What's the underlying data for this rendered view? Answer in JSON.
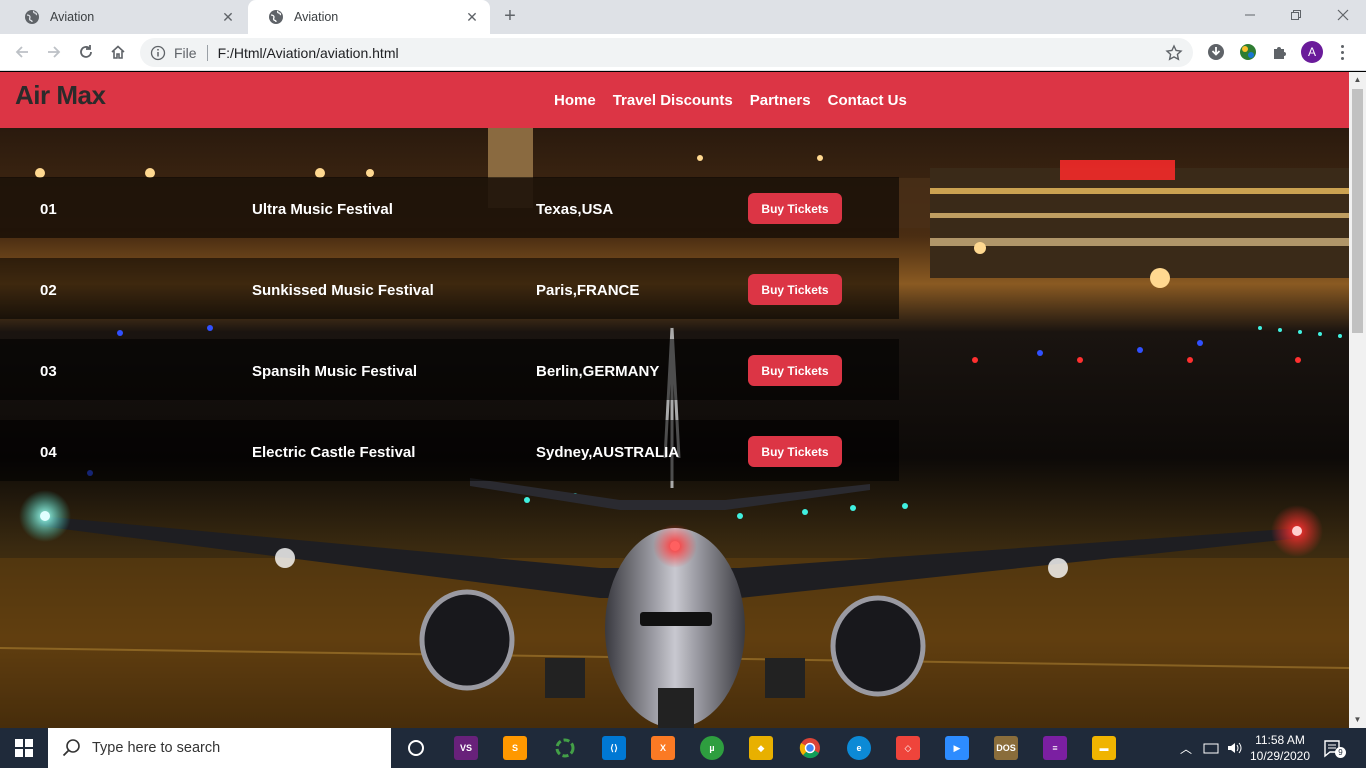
{
  "browser": {
    "tabs": [
      {
        "title": "Aviation",
        "active": false
      },
      {
        "title": "Aviation",
        "active": true
      }
    ],
    "address": {
      "scheme_label": "File",
      "url": "F:/Html/Aviation/aviation.html"
    }
  },
  "site": {
    "brand": "Air Max",
    "nav": [
      "Home",
      "Travel Discounts",
      "Partners",
      "Contact Us"
    ],
    "events": [
      {
        "num": "01",
        "name": "Ultra Music Festival",
        "place": "Texas,USA",
        "button": "Buy Tickets"
      },
      {
        "num": "02",
        "name": "Sunkissed Music Festival",
        "place": "Paris,FRANCE",
        "button": "Buy Tickets"
      },
      {
        "num": "03",
        "name": "Spansih Music Festival",
        "place": "Berlin,GERMANY",
        "button": "Buy Tickets"
      },
      {
        "num": "04",
        "name": "Electric Castle Festival",
        "place": "Sydney,AUSTRALIA",
        "button": "Buy Tickets"
      }
    ],
    "colors": {
      "accent": "#dc3545",
      "brand_text": "#2b2b2b"
    }
  },
  "taskbar": {
    "search_placeholder": "Type here to search",
    "time": "11:58 AM",
    "date": "10/29/2020",
    "notification_count": "9",
    "pinned": [
      "cortana-icon",
      "visual-studio-icon",
      "sublime-text-icon",
      "cycle-app-icon",
      "vscode-icon",
      "xampp-icon",
      "utorrent-icon",
      "sourcetree-icon",
      "chrome-icon",
      "edge-icon",
      "anydesk-icon",
      "zoom-icon",
      "dosbox-icon",
      "winrar-icon",
      "file-explorer-icon"
    ]
  }
}
